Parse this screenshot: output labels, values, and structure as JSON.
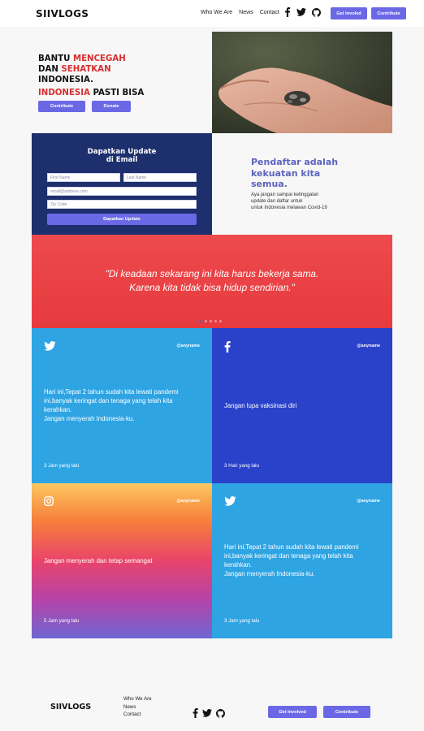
{
  "brand": "SIIVLOGS",
  "nav": {
    "links": [
      "Who We Are",
      "News",
      "Contact"
    ],
    "icons": [
      "facebook-icon",
      "twitter-icon",
      "github-icon"
    ],
    "get_involved": "Get Involed",
    "contribute": "Contribute"
  },
  "hero": {
    "line1_a": "BANTU ",
    "line1_b": "MENCEGAH",
    "line2_a": "DAN ",
    "line2_b": "SEHATKAN",
    "line3": "INDONESIA.",
    "line4_a": "INDONESIA",
    "line4_b": " PASTI BISA",
    "contribute": "Contribute",
    "donate": "Donate"
  },
  "signup": {
    "title_line1": "Dapatkan Update",
    "title_line2": "di Email",
    "first_name": "First Name",
    "last_name": "Last Name",
    "email": "email@address.com",
    "zip": "Zip Code",
    "button": "Dapatkan Update"
  },
  "tagline": {
    "heading": "Pendaftar adalah kekuatan kita semua.",
    "line1": "Aya jangan sampai ketinggalan",
    "line2": "update dan daftar untuk",
    "line3": "untuk Indonesia melawan Covid-19"
  },
  "quote": {
    "line1": "\"Di keadaan sekarang ini kita harus bekerja sama.",
    "line2": "Karena kita tidak bisa hidup sendirian.\""
  },
  "cards": [
    {
      "icon": "twitter-icon",
      "handle": "@anyname",
      "lines": [
        "Hari ini,Tepat 2 tahun sudah kita lewati pandemi",
        "ini,banyak keringat dan tenaga yang telah kita",
        "kerahkan.",
        "Jangan menyerah Indonesia-ku."
      ],
      "time": "3 Jam yang lalu"
    },
    {
      "icon": "facebook-icon",
      "handle": "@anyname",
      "lines": [
        "Jangan lupa vaksinasi diri"
      ],
      "time": "3 Hari yang lalu"
    },
    {
      "icon": "instagram-icon",
      "handle": "@anyname",
      "lines": [
        "Jangan menyerah dan tetap semangat"
      ],
      "time": "5 Jam yang lalu"
    },
    {
      "icon": "twitter-icon",
      "handle": "@anyname",
      "lines": [
        "Hari ini,Tepat 2 tahun sudah kita lewati pandemi",
        "ini,banyak keringat dan tenaga yang telah kita",
        "kerahkan.",
        "Jangan menyerah Indonesia-ku."
      ],
      "time": "3 Jam yang lalu"
    }
  ],
  "footer": {
    "brand": "SIIVLOGS",
    "links": [
      "Who We Are",
      "News",
      "Contact"
    ],
    "get_involved": "Get Involved",
    "contribute": "Contribute"
  },
  "colors": {
    "accent": "#6b68e6",
    "red": "#d92f2f",
    "navy": "#1d2f6c",
    "twitter": "#2ea4e3",
    "facebook": "#2a41c9"
  }
}
